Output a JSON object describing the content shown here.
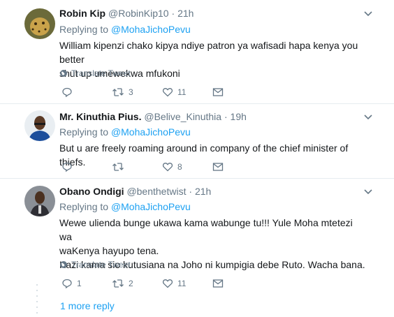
{
  "tweets": [
    {
      "name": "Robin Kip",
      "handle": "@RobinKip10",
      "time": "21h",
      "replying_label": "Replying to",
      "replying_to": "@MohaJichoPevu",
      "text_lines": [
        "William kipenzi chako kipya ndiye patron ya wafisadi hapa kenya you better",
        "shut up umewekwa mfukoni"
      ],
      "translate": "Translate Tweet",
      "actions": {
        "replies": "",
        "retweets": "3",
        "likes": "11"
      }
    },
    {
      "name": "Mr. Kinuthia Pius.",
      "handle": "@Belive_Kinuthia",
      "time": "19h",
      "replying_label": "Replying to",
      "replying_to": "@MohaJichoPevu",
      "text_lines": [
        "But u are freely roaming around in company of the chief minister of thiefs."
      ],
      "actions": {
        "replies": "",
        "retweets": "",
        "likes": "8"
      }
    },
    {
      "name": "Obano Ondigi",
      "handle": "@benthetwist",
      "time": "21h",
      "replying_label": "Replying to",
      "replying_to": "@MohaJichoPevu",
      "text_lines": [
        "Wewe ulienda bunge ukawa kama wabunge tu!!! Yule Moha mtetezi wa",
        "waKenya hayupo tena.",
        "Kazi kama sio kutusiana na Joho ni kumpigia debe Ruto. Wacha bana."
      ],
      "translate": "Translate Tweet",
      "actions": {
        "replies": "1",
        "retweets": "2",
        "likes": "11"
      }
    }
  ],
  "more_reply": "1 more reply",
  "colors": {
    "link": "#1da1f2",
    "muted": "#657786",
    "text": "#14171a",
    "divider": "#e6ecf0"
  }
}
